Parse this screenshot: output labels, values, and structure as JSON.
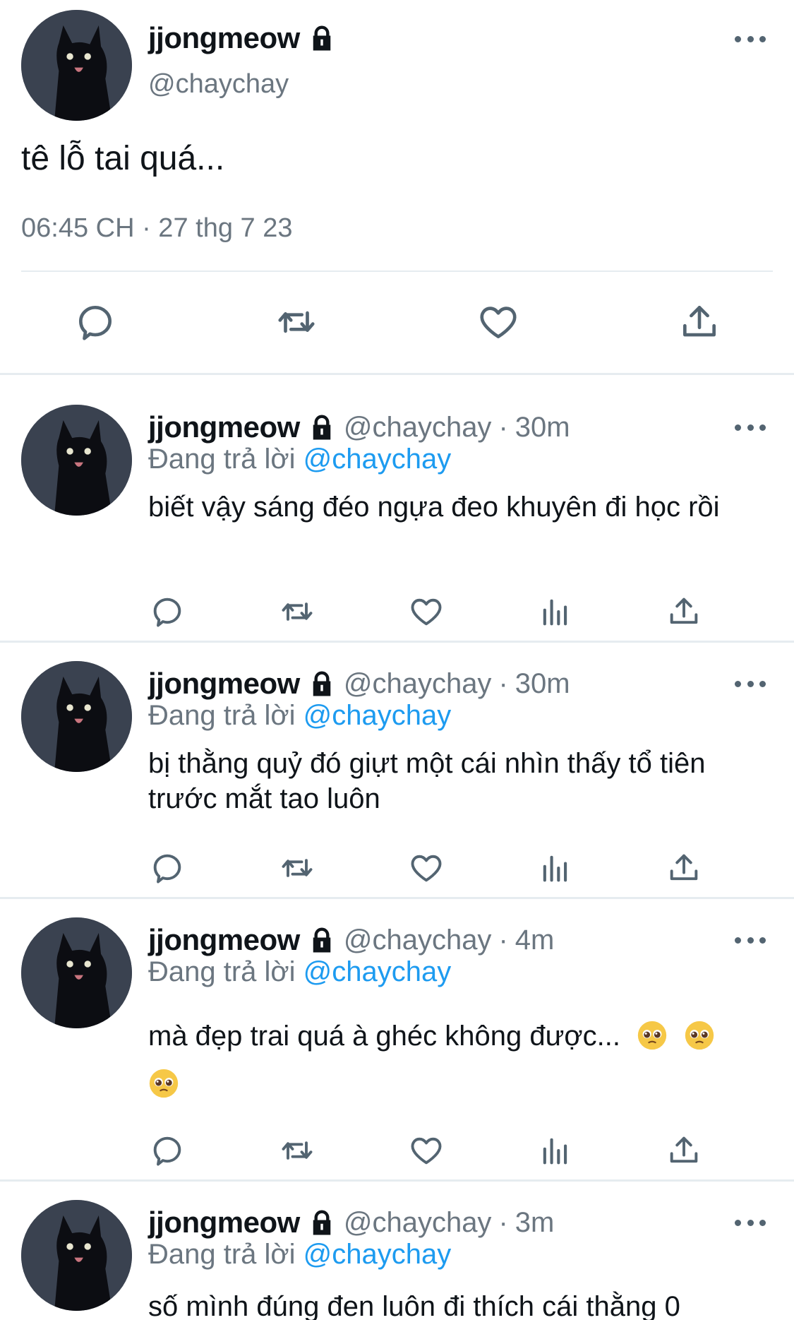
{
  "main_tweet": {
    "display_name": "jjongmeow",
    "handle": "@chaychay",
    "text": "tê lỗ tai quá...",
    "timestamp": "06:45 CH · 27 thg 7 23",
    "icons": [
      "reply-icon",
      "retweet-icon",
      "like-icon",
      "share-icon"
    ]
  },
  "replies": [
    {
      "display_name": "jjongmeow",
      "handle": "@chaychay",
      "dot": "·",
      "time": "30m",
      "replying_prefix": "Đang trả lời ",
      "replying_to": "@chaychay",
      "text": "biết vậy sáng đéo ngựa đeo khuyên đi học rồi"
    },
    {
      "display_name": "jjongmeow",
      "handle": "@chaychay",
      "dot": "·",
      "time": "30m",
      "replying_prefix": "Đang trả lời ",
      "replying_to": "@chaychay",
      "text": "bị thằng quỷ đó giựt một cái nhìn thấy tổ tiên trước mắt tao luôn"
    },
    {
      "display_name": "jjongmeow",
      "handle": "@chaychay",
      "dot": "·",
      "time": "4m",
      "replying_prefix": "Đang trả lời ",
      "replying_to": "@chaychay",
      "text": "mà đẹp trai quá à ghéc không được...",
      "emoji": "pleading-face"
    },
    {
      "display_name": "jjongmeow",
      "handle": "@chaychay",
      "dot": "·",
      "time": "3m",
      "replying_prefix": "Đang trả lời ",
      "replying_to": "@chaychay",
      "text": "số mình đúng đen luôn đi thích cái thằng 0"
    }
  ],
  "colors": {
    "text": "#0f1419",
    "secondary": "#6b7680",
    "mention": "#1d9bf0",
    "divider": "#e6ecf0",
    "icon": "#536471"
  }
}
